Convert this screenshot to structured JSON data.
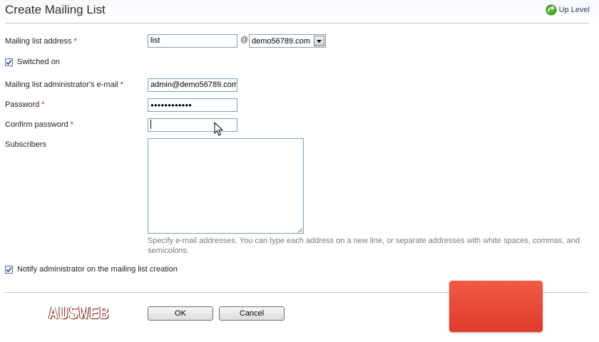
{
  "header": {
    "title": "Create Mailing List",
    "up_level_label": "Up Level"
  },
  "form": {
    "mailing_list_address": {
      "label": "Mailing list address",
      "required_mark": "*",
      "value": "list",
      "at_sign": "@",
      "domain_selected": "demo56789.com"
    },
    "switched_on": {
      "label": "Switched on",
      "checked": true
    },
    "admin_email": {
      "label": "Mailing list administrator's e-mail",
      "required_mark": "*",
      "value": "admin@demo56789.com"
    },
    "password": {
      "label": "Password",
      "required_mark": "*",
      "masked_value": "●●●●●●●●●●●●"
    },
    "confirm_password": {
      "label": "Confirm password",
      "required_mark": "*",
      "value": ""
    },
    "subscribers": {
      "label": "Subscribers",
      "value": "",
      "hint": "Specify e-mail addresses. You can type each address on a new line, or separate addresses with white spaces, commas, and semicolons."
    },
    "notify_admin": {
      "label": "Notify administrator on the mailing list creation",
      "checked": true
    }
  },
  "buttons": {
    "ok_label": "OK",
    "cancel_label": "Cancel"
  },
  "watermark": {
    "text": "AUSWEB"
  },
  "colors": {
    "required": "#d6141b",
    "accent": "#1f3c63",
    "watermark": "#e84a3a"
  },
  "icons": {
    "up_level": "green-up-arrow-icon",
    "select": "chevron-down-icon",
    "cursor": "mouse-pointer-icon"
  }
}
